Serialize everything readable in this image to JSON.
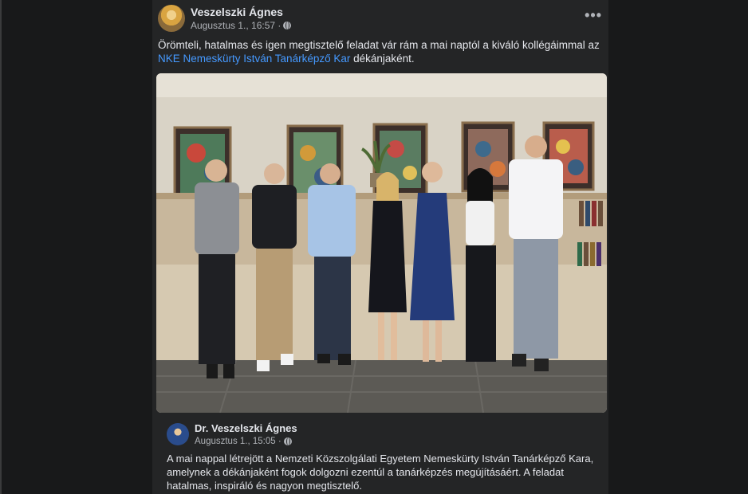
{
  "post": {
    "author": "Veszelszki Ágnes",
    "date": "Augusztus 1., 16:57 ·",
    "audience_icon": "globe-icon",
    "more_label": "•••",
    "text_before": "Örömteli, hatalmas és igen megtisztelő feladat vár rám a mai naptól a kiváló kollégáimmal az ",
    "link_text": "NKE Nemeskürty István Tanárképző Kar",
    "text_after": " dékánjaként."
  },
  "shared_post": {
    "author": "Dr. Veszelszki Ágnes",
    "date": "Augusztus 1., 15:05 ·",
    "audience_icon": "globe-icon",
    "text": "A mai nappal létrejött a Nemzeti Közszolgálati Egyetem Nemeskürty István Tanárképző Kara, amelynek a dékánjaként fogok dolgozni ezentúl a tanárképzés megújításáért. A feladat hatalmas, inspiráló és nagyon megtisztelő."
  },
  "colors": {
    "background": "#18191a",
    "card": "#242526",
    "text": "#e4e6eb",
    "secondary_text": "#b0b3b8",
    "link": "#4599ff"
  }
}
